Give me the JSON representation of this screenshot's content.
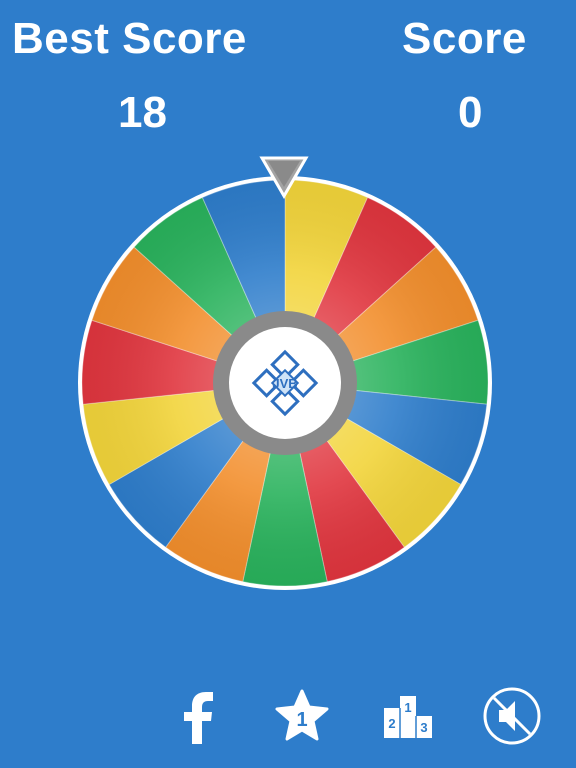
{
  "header": {
    "best_score_label": "Best Score",
    "best_score_value": "18",
    "score_label": "Score",
    "score_value": "0"
  },
  "wheel": {
    "center_logo_text": "JVB",
    "segments": [
      "yellow",
      "red",
      "orange",
      "green",
      "blue",
      "yellow",
      "red",
      "green",
      "orange",
      "blue",
      "yellow",
      "red",
      "orange",
      "green",
      "blue"
    ],
    "rotation_offset_deg": 0
  },
  "leaderboard_icon": {
    "podium_labels": [
      "2",
      "1",
      "3"
    ]
  },
  "icons": {
    "facebook": "facebook-icon",
    "rate": "star-icon",
    "leaderboard": "leaderboard-icon",
    "sound": "sound-muted-icon"
  },
  "colors": {
    "background": "#2e7dcb",
    "yellow": "#f2d43a",
    "red": "#e0353e",
    "orange": "#f28e2c",
    "green": "#29b25c",
    "blue": "#2e7dcb",
    "hub_ring": "#8a8a8a",
    "pointer": "#a0a0a0"
  }
}
